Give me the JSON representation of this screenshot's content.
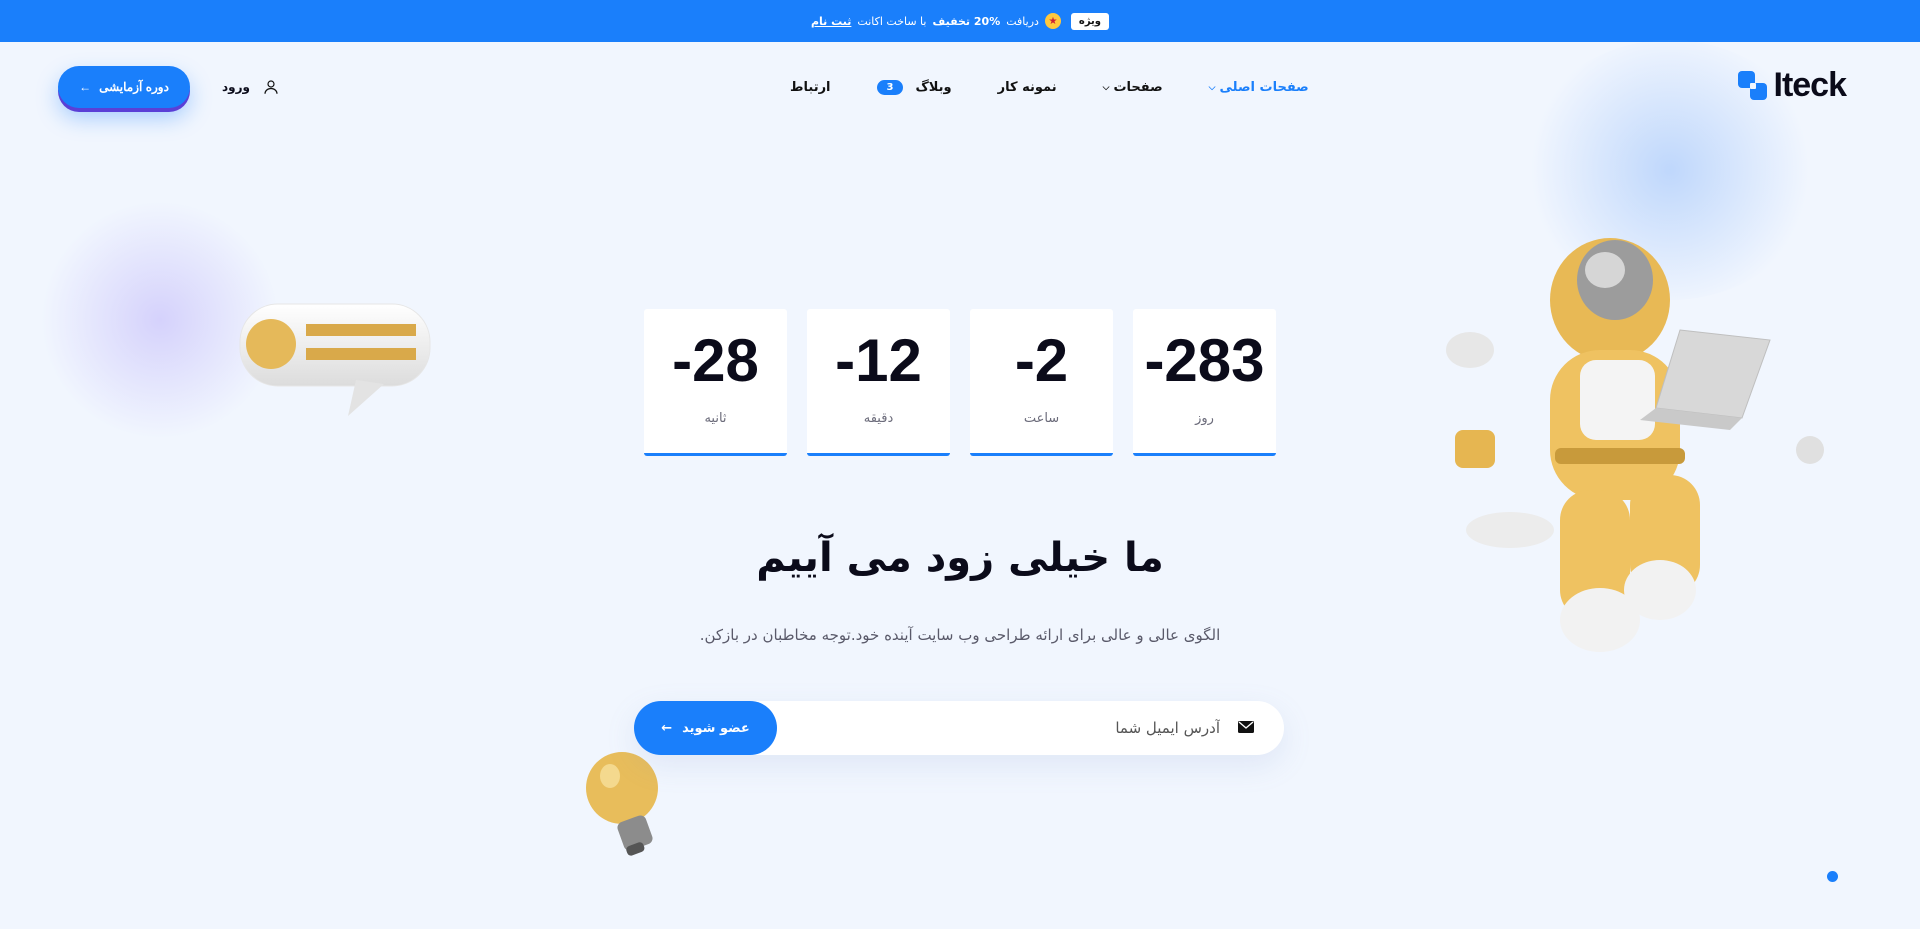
{
  "topbar": {
    "badge": "ویژه",
    "text_before": "دریافت",
    "discount": "20% تخفیف",
    "text_after": "با ساخت اکانت",
    "link": "ثبت نام"
  },
  "header": {
    "logo_text": "Iteck",
    "nav": {
      "home": "صفحات اصلی",
      "pages": "صفحات",
      "portfolio": "نمونه کار",
      "blog": "وبلاگ",
      "blog_count": "3",
      "contact": "ارتباط"
    },
    "login_label": "ورود",
    "trial_button": "دوره آزمایشی"
  },
  "countdown": {
    "days": {
      "value": "-283",
      "label": "روز"
    },
    "hours": {
      "value": "-2",
      "label": "ساعت"
    },
    "minutes": {
      "value": "-12",
      "label": "دقیقه"
    },
    "seconds": {
      "value": "-28",
      "label": "ثانیه"
    }
  },
  "hero": {
    "title": "ما خیلی زود می آییم",
    "subtitle": "الگوی عالی و عالی برای ارائه طراحی وب سایت آینده خود.توجه مخاطبان در بازکن."
  },
  "subscribe": {
    "placeholder": "آدرس ایمیل شما",
    "button_label": "عضو شوید"
  },
  "colors": {
    "accent": "#1a7ffb",
    "background": "#f1f6fe",
    "illustration_gold": "#e9bb55"
  },
  "icons": {
    "user": "user-icon",
    "mail": "mail-icon",
    "arrow": "arrow-left-icon",
    "chevron": "chevron-down-icon"
  }
}
